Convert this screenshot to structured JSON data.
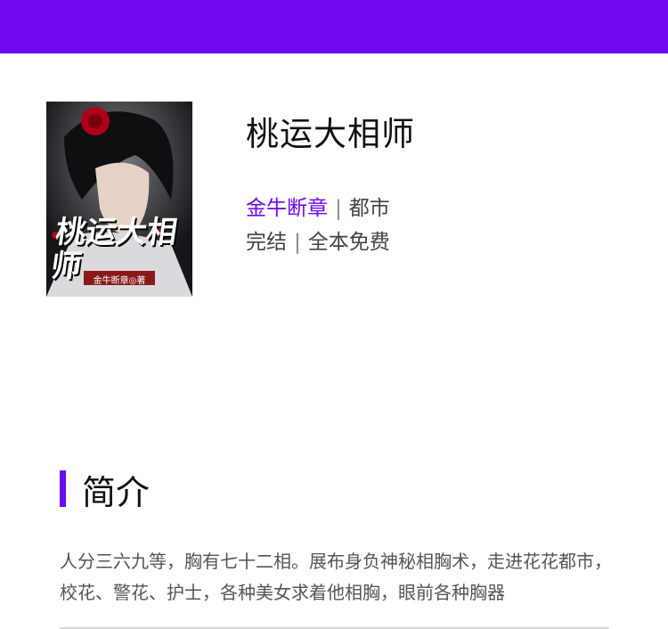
{
  "book": {
    "title": "桃运大相师",
    "author": "金牛断章",
    "category": "都市",
    "status": "完结",
    "price": "全本免费",
    "separator": "|",
    "cover": {
      "title_text": "桃运大相师",
      "author_badge": "金牛断章◎著"
    }
  },
  "intro": {
    "heading": "简介",
    "text": "人分三六九等，胸有七十二相。展布身负神秘相胸术，走进花花都市，校花、警花、护士，各种美女求着他相胸，眼前各种胸器"
  },
  "colors": {
    "accent": "#7008f2"
  }
}
